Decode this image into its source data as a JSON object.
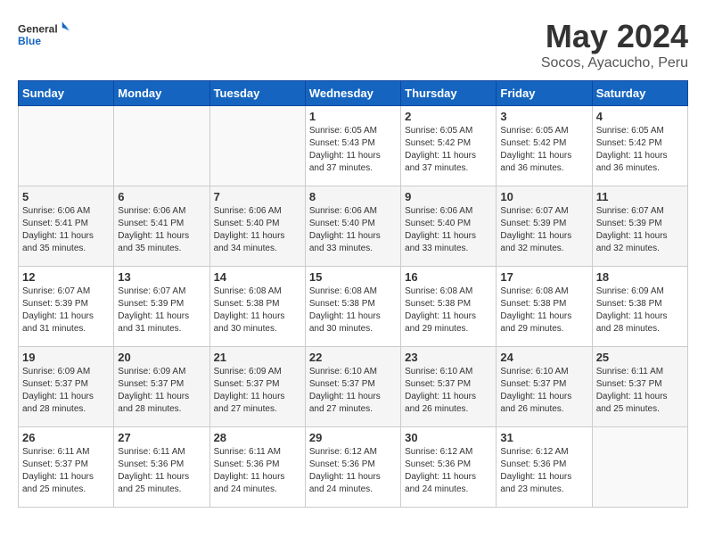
{
  "header": {
    "logo_general": "General",
    "logo_blue": "Blue",
    "month": "May 2024",
    "location": "Socos, Ayacucho, Peru"
  },
  "weekdays": [
    "Sunday",
    "Monday",
    "Tuesday",
    "Wednesday",
    "Thursday",
    "Friday",
    "Saturday"
  ],
  "weeks": [
    [
      {
        "day": "",
        "info": ""
      },
      {
        "day": "",
        "info": ""
      },
      {
        "day": "",
        "info": ""
      },
      {
        "day": "1",
        "info": "Sunrise: 6:05 AM\nSunset: 5:43 PM\nDaylight: 11 hours\nand 37 minutes."
      },
      {
        "day": "2",
        "info": "Sunrise: 6:05 AM\nSunset: 5:42 PM\nDaylight: 11 hours\nand 37 minutes."
      },
      {
        "day": "3",
        "info": "Sunrise: 6:05 AM\nSunset: 5:42 PM\nDaylight: 11 hours\nand 36 minutes."
      },
      {
        "day": "4",
        "info": "Sunrise: 6:05 AM\nSunset: 5:42 PM\nDaylight: 11 hours\nand 36 minutes."
      }
    ],
    [
      {
        "day": "5",
        "info": "Sunrise: 6:06 AM\nSunset: 5:41 PM\nDaylight: 11 hours\nand 35 minutes."
      },
      {
        "day": "6",
        "info": "Sunrise: 6:06 AM\nSunset: 5:41 PM\nDaylight: 11 hours\nand 35 minutes."
      },
      {
        "day": "7",
        "info": "Sunrise: 6:06 AM\nSunset: 5:40 PM\nDaylight: 11 hours\nand 34 minutes."
      },
      {
        "day": "8",
        "info": "Sunrise: 6:06 AM\nSunset: 5:40 PM\nDaylight: 11 hours\nand 33 minutes."
      },
      {
        "day": "9",
        "info": "Sunrise: 6:06 AM\nSunset: 5:40 PM\nDaylight: 11 hours\nand 33 minutes."
      },
      {
        "day": "10",
        "info": "Sunrise: 6:07 AM\nSunset: 5:39 PM\nDaylight: 11 hours\nand 32 minutes."
      },
      {
        "day": "11",
        "info": "Sunrise: 6:07 AM\nSunset: 5:39 PM\nDaylight: 11 hours\nand 32 minutes."
      }
    ],
    [
      {
        "day": "12",
        "info": "Sunrise: 6:07 AM\nSunset: 5:39 PM\nDaylight: 11 hours\nand 31 minutes."
      },
      {
        "day": "13",
        "info": "Sunrise: 6:07 AM\nSunset: 5:39 PM\nDaylight: 11 hours\nand 31 minutes."
      },
      {
        "day": "14",
        "info": "Sunrise: 6:08 AM\nSunset: 5:38 PM\nDaylight: 11 hours\nand 30 minutes."
      },
      {
        "day": "15",
        "info": "Sunrise: 6:08 AM\nSunset: 5:38 PM\nDaylight: 11 hours\nand 30 minutes."
      },
      {
        "day": "16",
        "info": "Sunrise: 6:08 AM\nSunset: 5:38 PM\nDaylight: 11 hours\nand 29 minutes."
      },
      {
        "day": "17",
        "info": "Sunrise: 6:08 AM\nSunset: 5:38 PM\nDaylight: 11 hours\nand 29 minutes."
      },
      {
        "day": "18",
        "info": "Sunrise: 6:09 AM\nSunset: 5:38 PM\nDaylight: 11 hours\nand 28 minutes."
      }
    ],
    [
      {
        "day": "19",
        "info": "Sunrise: 6:09 AM\nSunset: 5:37 PM\nDaylight: 11 hours\nand 28 minutes."
      },
      {
        "day": "20",
        "info": "Sunrise: 6:09 AM\nSunset: 5:37 PM\nDaylight: 11 hours\nand 28 minutes."
      },
      {
        "day": "21",
        "info": "Sunrise: 6:09 AM\nSunset: 5:37 PM\nDaylight: 11 hours\nand 27 minutes."
      },
      {
        "day": "22",
        "info": "Sunrise: 6:10 AM\nSunset: 5:37 PM\nDaylight: 11 hours\nand 27 minutes."
      },
      {
        "day": "23",
        "info": "Sunrise: 6:10 AM\nSunset: 5:37 PM\nDaylight: 11 hours\nand 26 minutes."
      },
      {
        "day": "24",
        "info": "Sunrise: 6:10 AM\nSunset: 5:37 PM\nDaylight: 11 hours\nand 26 minutes."
      },
      {
        "day": "25",
        "info": "Sunrise: 6:11 AM\nSunset: 5:37 PM\nDaylight: 11 hours\nand 25 minutes."
      }
    ],
    [
      {
        "day": "26",
        "info": "Sunrise: 6:11 AM\nSunset: 5:37 PM\nDaylight: 11 hours\nand 25 minutes."
      },
      {
        "day": "27",
        "info": "Sunrise: 6:11 AM\nSunset: 5:36 PM\nDaylight: 11 hours\nand 25 minutes."
      },
      {
        "day": "28",
        "info": "Sunrise: 6:11 AM\nSunset: 5:36 PM\nDaylight: 11 hours\nand 24 minutes."
      },
      {
        "day": "29",
        "info": "Sunrise: 6:12 AM\nSunset: 5:36 PM\nDaylight: 11 hours\nand 24 minutes."
      },
      {
        "day": "30",
        "info": "Sunrise: 6:12 AM\nSunset: 5:36 PM\nDaylight: 11 hours\nand 24 minutes."
      },
      {
        "day": "31",
        "info": "Sunrise: 6:12 AM\nSunset: 5:36 PM\nDaylight: 11 hours\nand 23 minutes."
      },
      {
        "day": "",
        "info": ""
      }
    ]
  ]
}
